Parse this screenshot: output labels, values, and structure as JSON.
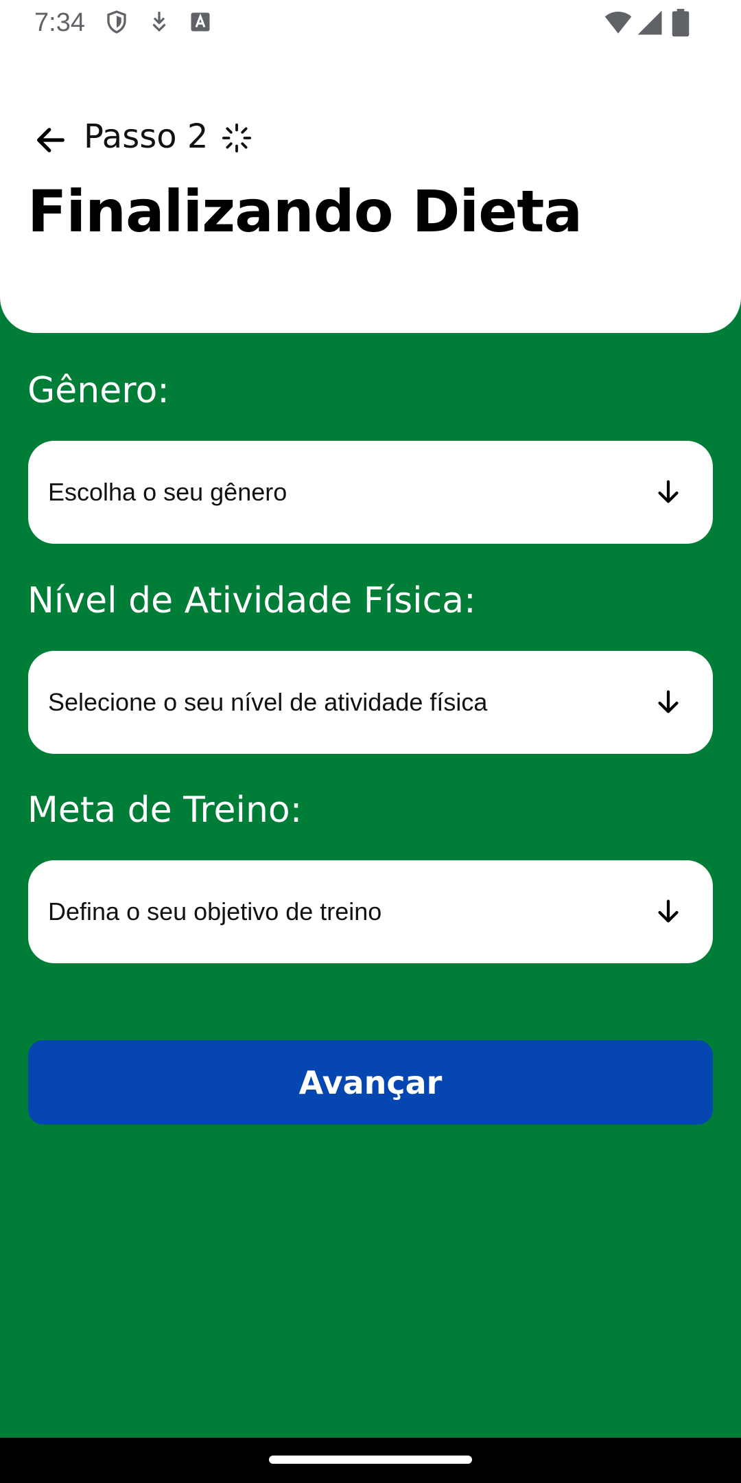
{
  "status_bar": {
    "time": "7:34",
    "icons_left": [
      "shield-icon",
      "download-icon",
      "keyboard-a-icon"
    ],
    "icons_right": [
      "wifi-icon",
      "signal-icon",
      "battery-icon"
    ]
  },
  "header": {
    "back_icon": "arrow-left-icon",
    "step_label": "Passo 2",
    "step_icon": "spinner-icon",
    "title": "Finalizando Dieta"
  },
  "form": {
    "gender": {
      "label": "Gênero:",
      "placeholder": "Escolha o seu gênero"
    },
    "activity": {
      "label": "Nível de Atividade Física:",
      "placeholder": "Selecione o seu nível de atividade física"
    },
    "goal": {
      "label": "Meta de Treino:",
      "placeholder": "Defina o seu objetivo de treino"
    },
    "dropdown_icon": "arrow-down-icon",
    "submit_label": "Avançar"
  },
  "colors": {
    "background": "#007D36",
    "card": "#FFFFFF",
    "button": "#0546B0",
    "button_text": "#FFFFFF"
  }
}
